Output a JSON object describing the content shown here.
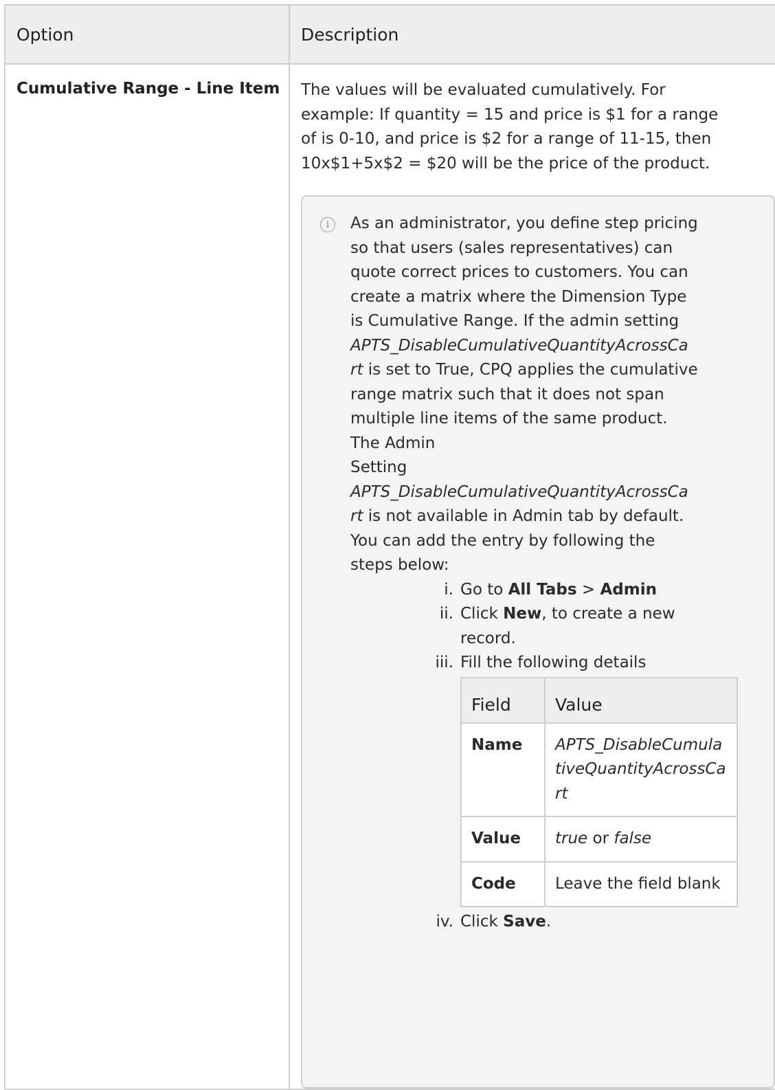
{
  "table": {
    "headers": [
      "Option",
      "Description"
    ],
    "row": {
      "option": "Cumulative Range - Line Item",
      "description_lines": [
        "The values will be evaluated cumulatively. For",
        "example: If quantity = 15 and price is $1 for a range",
        "of is 0-10, and price is $2 for a range of 11-15, then",
        "10x$1+5x$2 = $20 will be the price of the product."
      ]
    }
  },
  "note": {
    "icon": "info-icon",
    "lines": [
      "As an administrator, you define step pricing",
      "so that users (sales representatives) can",
      "quote correct prices to customers. You can",
      "create a matrix where the Dimension Type",
      "is Cumulative Range. If the admin setting"
    ],
    "setting_part1": "APTS_DisableCumulativeQuantityAcrossCa",
    "setting_part2": "rt",
    "after_setting_1": " is set to True, CPQ applies the cumulative",
    "lines_2": [
      "range matrix such that it does not span",
      "multiple line items of the same product.",
      "The Admin",
      "Setting"
    ],
    "after_setting_2": " is not available in Admin tab by default.",
    "lines_3": [
      "You can add the entry by following the",
      "steps below:"
    ]
  },
  "steps": [
    {
      "num": "i.",
      "pre": "Go to ",
      "b1": "All Tabs",
      "mid": " > ",
      "b2": "Admin"
    },
    {
      "num": "ii.",
      "pre": "Click ",
      "b1": "New",
      "post": ", to create a new",
      "post2": "record."
    },
    {
      "num": "iii.",
      "text": "Fill the following details"
    },
    {
      "num": "iv.",
      "pre": "Click ",
      "b1": "Save",
      "post": "."
    }
  ],
  "settings_table": {
    "headers": [
      "Field",
      "Value"
    ],
    "rows": [
      {
        "field": "Name",
        "value": "APTS_DisableCumulativeQuantityAcrossCart"
      },
      {
        "field": "Value",
        "value_a": "true",
        "value_or": " or ",
        "value_b": "false"
      },
      {
        "field": "Code",
        "value": "Leave the field blank"
      }
    ]
  }
}
